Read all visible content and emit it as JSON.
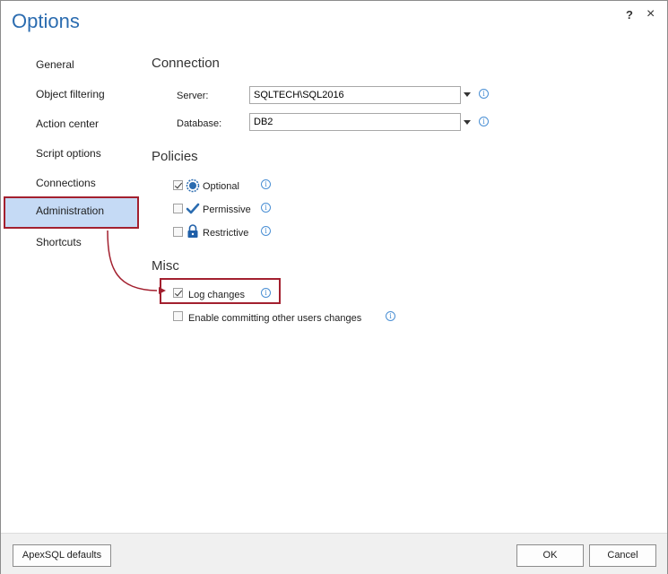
{
  "window": {
    "title": "Options",
    "help_label": "?",
    "close_label": "×"
  },
  "nav": {
    "items": [
      {
        "label": "General"
      },
      {
        "label": "Object filtering"
      },
      {
        "label": "Action center"
      },
      {
        "label": "Script options"
      },
      {
        "label": "Connections"
      },
      {
        "label": "Administration",
        "active": true
      },
      {
        "label": "Shortcuts"
      }
    ]
  },
  "connection": {
    "heading": "Connection",
    "server_label": "Server:",
    "server_value": "SQLTECH\\SQL2016",
    "database_label": "Database:",
    "database_value": "DB2"
  },
  "policies": {
    "heading": "Policies",
    "items": [
      {
        "label": "Optional",
        "checked": true,
        "icon": "optional-circle-icon"
      },
      {
        "label": "Permissive",
        "checked": false,
        "icon": "checkmark-icon"
      },
      {
        "label": "Restrictive",
        "checked": false,
        "icon": "lock-icon"
      }
    ]
  },
  "misc": {
    "heading": "Misc",
    "log_changes_label": "Log changes",
    "log_changes_checked": true,
    "enable_committing_label": "Enable committing other users changes",
    "enable_committing_checked": false
  },
  "info_glyph": "i",
  "footer": {
    "defaults_label": "ApexSQL defaults",
    "ok_label": "OK",
    "cancel_label": "Cancel"
  },
  "colors": {
    "accent": "#2b6cb0",
    "highlight_border": "#a3202f",
    "active_nav_bg": "#c5daf5",
    "icon_blue": "#2b6cb0"
  }
}
